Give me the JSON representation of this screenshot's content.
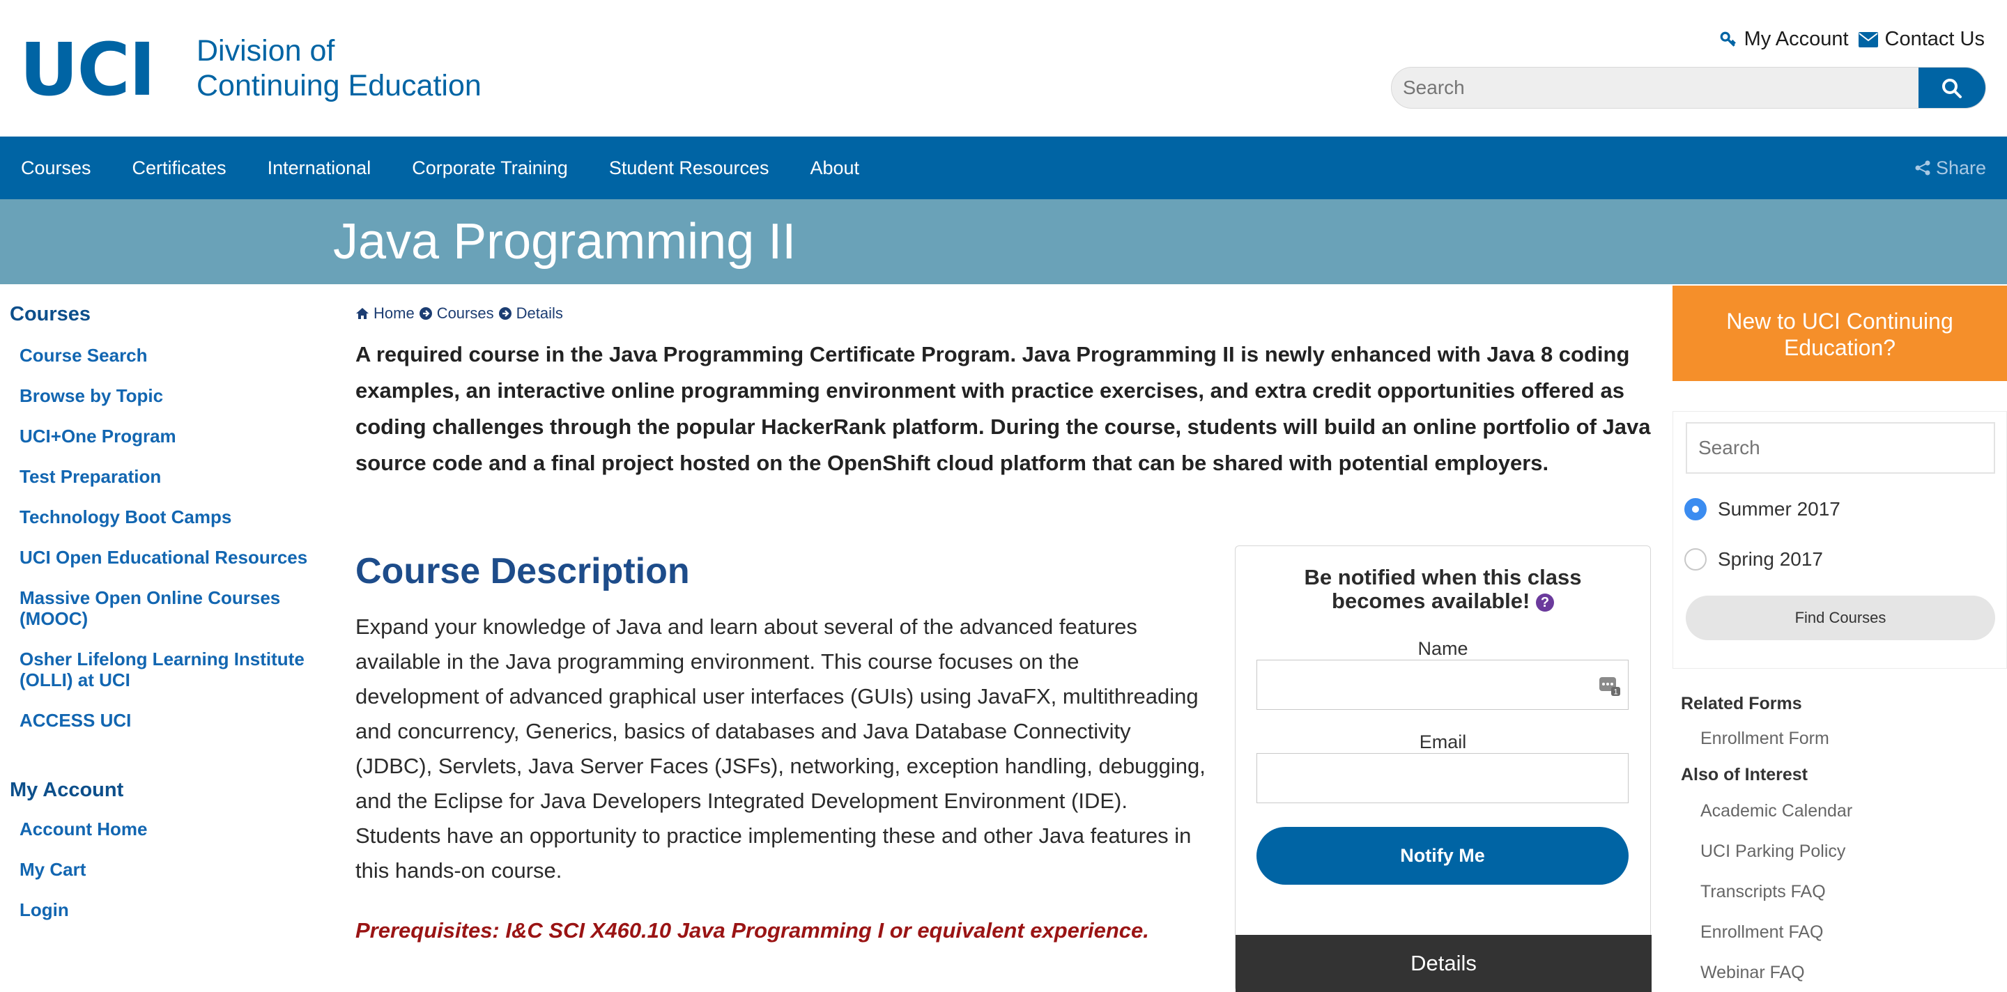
{
  "header": {
    "logo_uci": "UCI",
    "logo_line1": "Division of",
    "logo_line2": "Continuing Education",
    "my_account": "My Account",
    "contact_us": "Contact Us",
    "search_placeholder": "Search"
  },
  "nav": {
    "items": [
      "Courses",
      "Certificates",
      "International",
      "Corporate Training",
      "Student Resources",
      "About"
    ],
    "share": "Share"
  },
  "banner": {
    "title": "Java Programming II"
  },
  "sidebar": {
    "courses_heading": "Courses",
    "course_links": [
      "Course Search",
      "Browse by Topic",
      "UCI+One Program",
      "Test Preparation",
      "Technology Boot Camps",
      "UCI Open Educational Resources",
      "Massive Open Online Courses (MOOC)",
      "Osher Lifelong Learning Institute (OLLI) at UCI",
      "ACCESS UCI"
    ],
    "account_heading": "My Account",
    "account_links": [
      "Account Home",
      "My Cart",
      "Login"
    ]
  },
  "breadcrumb": [
    "Home",
    "Courses",
    "Details"
  ],
  "main": {
    "intro": "A required course in the Java Programming Certificate Program. Java Programming II is newly enhanced with Java 8 coding examples, an interactive online programming environment with practice exercises, and extra credit opportunities offered as coding challenges through the popular HackerRank platform. During the course, students will build an online portfolio of Java source code and a final project hosted on the OpenShift cloud platform that can be shared with potential employers.",
    "course_description_title": "Course Description",
    "description": "Expand your knowledge of Java and learn about several of the advanced features available in the Java programming environment. This course focuses on the development of advanced graphical user interfaces (GUIs) using JavaFX, multithreading and concurrency, Generics, basics of databases and Java Database Connectivity (JDBC), Servlets, Java Server Faces (JSFs), networking, exception handling, debugging, and the Eclipse for Java Developers Integrated Development Environment (IDE). Students have an opportunity to practice implementing these and other Java features in this hands-on course.",
    "prerequisites": "Prerequisites: I&C SCI X460.10 Java Programming I or equivalent experience."
  },
  "notify": {
    "title_line1": "Be notified when this class",
    "title_line2": "becomes available!",
    "help_symbol": "?",
    "name_label": "Name",
    "email_label": "Email",
    "button": "Notify Me",
    "details": "Details"
  },
  "right": {
    "new_box": "New to UCI Continuing Education?",
    "search_placeholder": "Search",
    "terms": [
      {
        "label": "Summer 2017",
        "selected": true
      },
      {
        "label": "Spring 2017",
        "selected": false
      }
    ],
    "find_courses": "Find Courses",
    "related_forms_heading": "Related Forms",
    "related_forms": [
      "Enrollment Form"
    ],
    "also_heading": "Also of Interest",
    "also_links": [
      "Academic Calendar",
      "UCI Parking Policy",
      "Transcripts FAQ",
      "Enrollment FAQ",
      "Webinar FAQ"
    ]
  },
  "colors": {
    "brand_blue": "#0064a4",
    "banner": "#6aa2b8",
    "orange": "#f58f2a",
    "prereq_red": "#9a1414"
  }
}
